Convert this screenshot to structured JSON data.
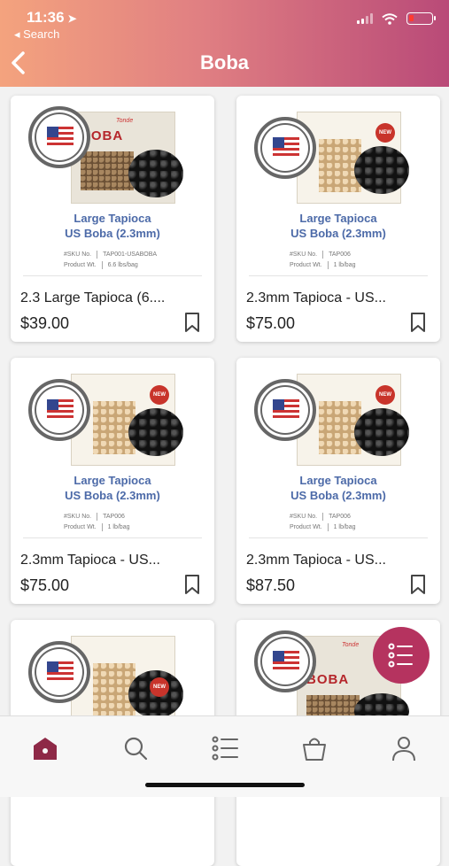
{
  "status_bar": {
    "time": "11:36",
    "location_arrow": "➤",
    "back_app": "◂ Search"
  },
  "header": {
    "title": "Boba",
    "back_icon": "chevron-left-icon"
  },
  "products": [
    {
      "name": "2.3 Large Tapioca  (6....",
      "price": "$39.00",
      "package": {
        "brand": "Tonde",
        "title": "BOBA",
        "caption_line1": "Large Tapioca",
        "caption_line2": "US Boba (2.3mm)",
        "sku_label": "#SKU No.",
        "sku_value": "TAP001-USABOBA",
        "weight_label": "Product Wt.",
        "weight_value": "6.6 lbs/bag"
      }
    },
    {
      "name": "2.3mm Tapioca - US...",
      "price": "$75.00",
      "package": {
        "badge": "NEW",
        "caption_line1": "Large Tapioca",
        "caption_line2": "US Boba (2.3mm)",
        "sku_label": "#SKU No.",
        "sku_value": "TAP006",
        "weight_label": "Product Wt.",
        "weight_value": "1 lb/bag"
      }
    },
    {
      "name": "2.3mm Tapioca - US...",
      "price": "$75.00",
      "package": {
        "badge": "NEW",
        "caption_line1": "Large Tapioca",
        "caption_line2": "US Boba (2.3mm)",
        "sku_label": "#SKU No.",
        "sku_value": "TAP006",
        "weight_label": "Product Wt.",
        "weight_value": "1 lb/bag"
      }
    },
    {
      "name": "2.3mm Tapioca - US...",
      "price": "$87.50",
      "package": {
        "badge": "NEW",
        "caption_line1": "Large Tapioca",
        "caption_line2": "US Boba (2.3mm)",
        "sku_label": "#SKU No.",
        "sku_value": "TAP006",
        "weight_label": "Product Wt.",
        "weight_value": "1 lb/bag"
      }
    },
    {
      "package": {
        "badge": "NEW"
      }
    },
    {
      "package": {
        "brand": "Tonde",
        "title": "BOBA"
      }
    }
  ],
  "tab_bar": [
    {
      "name": "home",
      "icon": "home-icon",
      "active": true
    },
    {
      "name": "search",
      "icon": "search-icon",
      "active": false
    },
    {
      "name": "categories",
      "icon": "list-icon",
      "active": false
    },
    {
      "name": "cart",
      "icon": "bag-icon",
      "active": false
    },
    {
      "name": "account",
      "icon": "user-icon",
      "active": false
    }
  ],
  "colors": {
    "brand": "#b5335f",
    "header_start": "#f4a37e",
    "header_end": "#b94a78",
    "caption_blue": "#4c6aa8"
  }
}
